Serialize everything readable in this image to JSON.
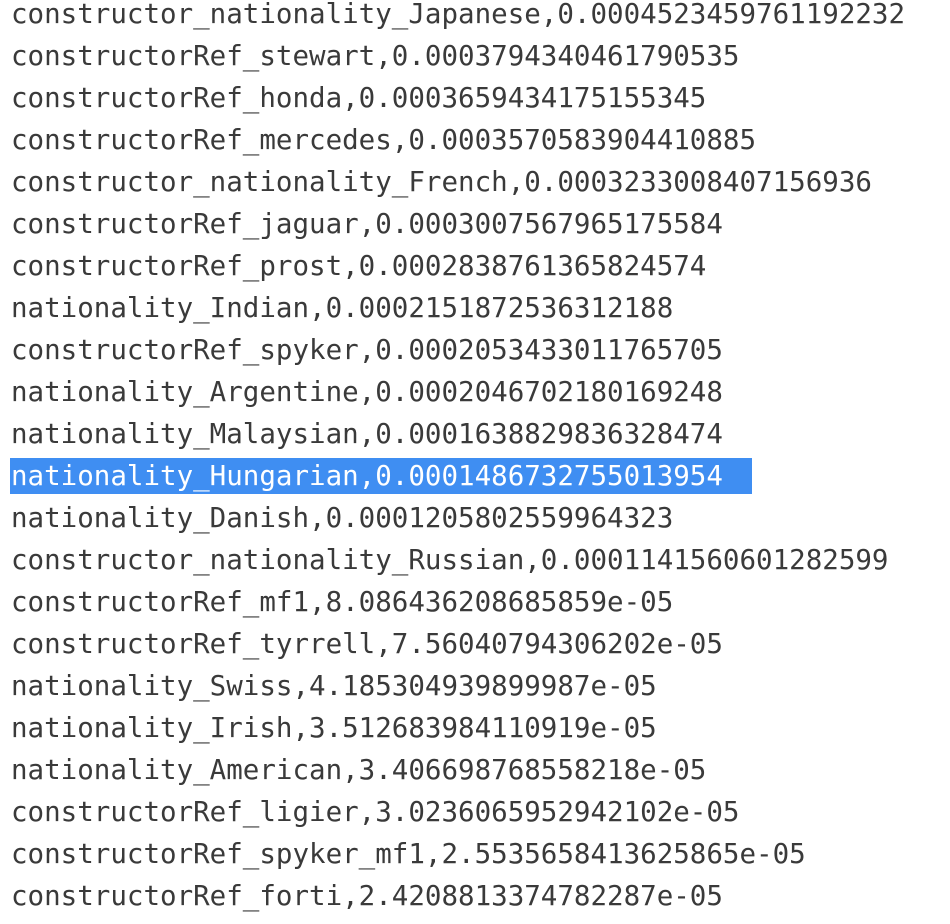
{
  "colors": {
    "text": "#3a3a3a",
    "selection_background": "#3f8ef2",
    "selection_text": "#ffffff",
    "background": "#ffffff"
  },
  "lines": [
    {
      "text": "constructor_nationality_Japanese,0.0004523459761192232",
      "selected": false
    },
    {
      "text": "constructorRef_stewart,0.0003794340461790535",
      "selected": false
    },
    {
      "text": "constructorRef_honda,0.0003659434175155345",
      "selected": false
    },
    {
      "text": "constructorRef_mercedes,0.0003570583904410885",
      "selected": false
    },
    {
      "text": "constructor_nationality_French,0.0003233008407156936",
      "selected": false
    },
    {
      "text": "constructorRef_jaguar,0.0003007567965175584",
      "selected": false
    },
    {
      "text": "constructorRef_prost,0.0002838761365824574",
      "selected": false
    },
    {
      "text": "nationality_Indian,0.0002151872536312188",
      "selected": false
    },
    {
      "text": "constructorRef_spyker,0.0002053433011765705",
      "selected": false
    },
    {
      "text": "nationality_Argentine,0.0002046702180169248",
      "selected": false
    },
    {
      "text": "nationality_Malaysian,0.0001638829836328474",
      "selected": false
    },
    {
      "text": "nationality_Hungarian,0.0001486732755013954",
      "selected": true
    },
    {
      "text": "nationality_Danish,0.0001205802559964323",
      "selected": false
    },
    {
      "text": "constructor_nationality_Russian,0.0001141560601282599",
      "selected": false
    },
    {
      "text": "constructorRef_mf1,8.086436208685859e-05",
      "selected": false
    },
    {
      "text": "constructorRef_tyrrell,7.56040794306202e-05",
      "selected": false
    },
    {
      "text": "nationality_Swiss,4.185304939899987e-05",
      "selected": false
    },
    {
      "text": "nationality_Irish,3.512683984110919e-05",
      "selected": false
    },
    {
      "text": "nationality_American,3.406698768558218e-05",
      "selected": false
    },
    {
      "text": "constructorRef_ligier,3.0236065952942102e-05",
      "selected": false
    },
    {
      "text": "constructorRef_spyker_mf1,2.5535658413625865e-05",
      "selected": false
    },
    {
      "text": "constructorRef_forti,2.4208813374782287e-05",
      "selected": false
    }
  ]
}
